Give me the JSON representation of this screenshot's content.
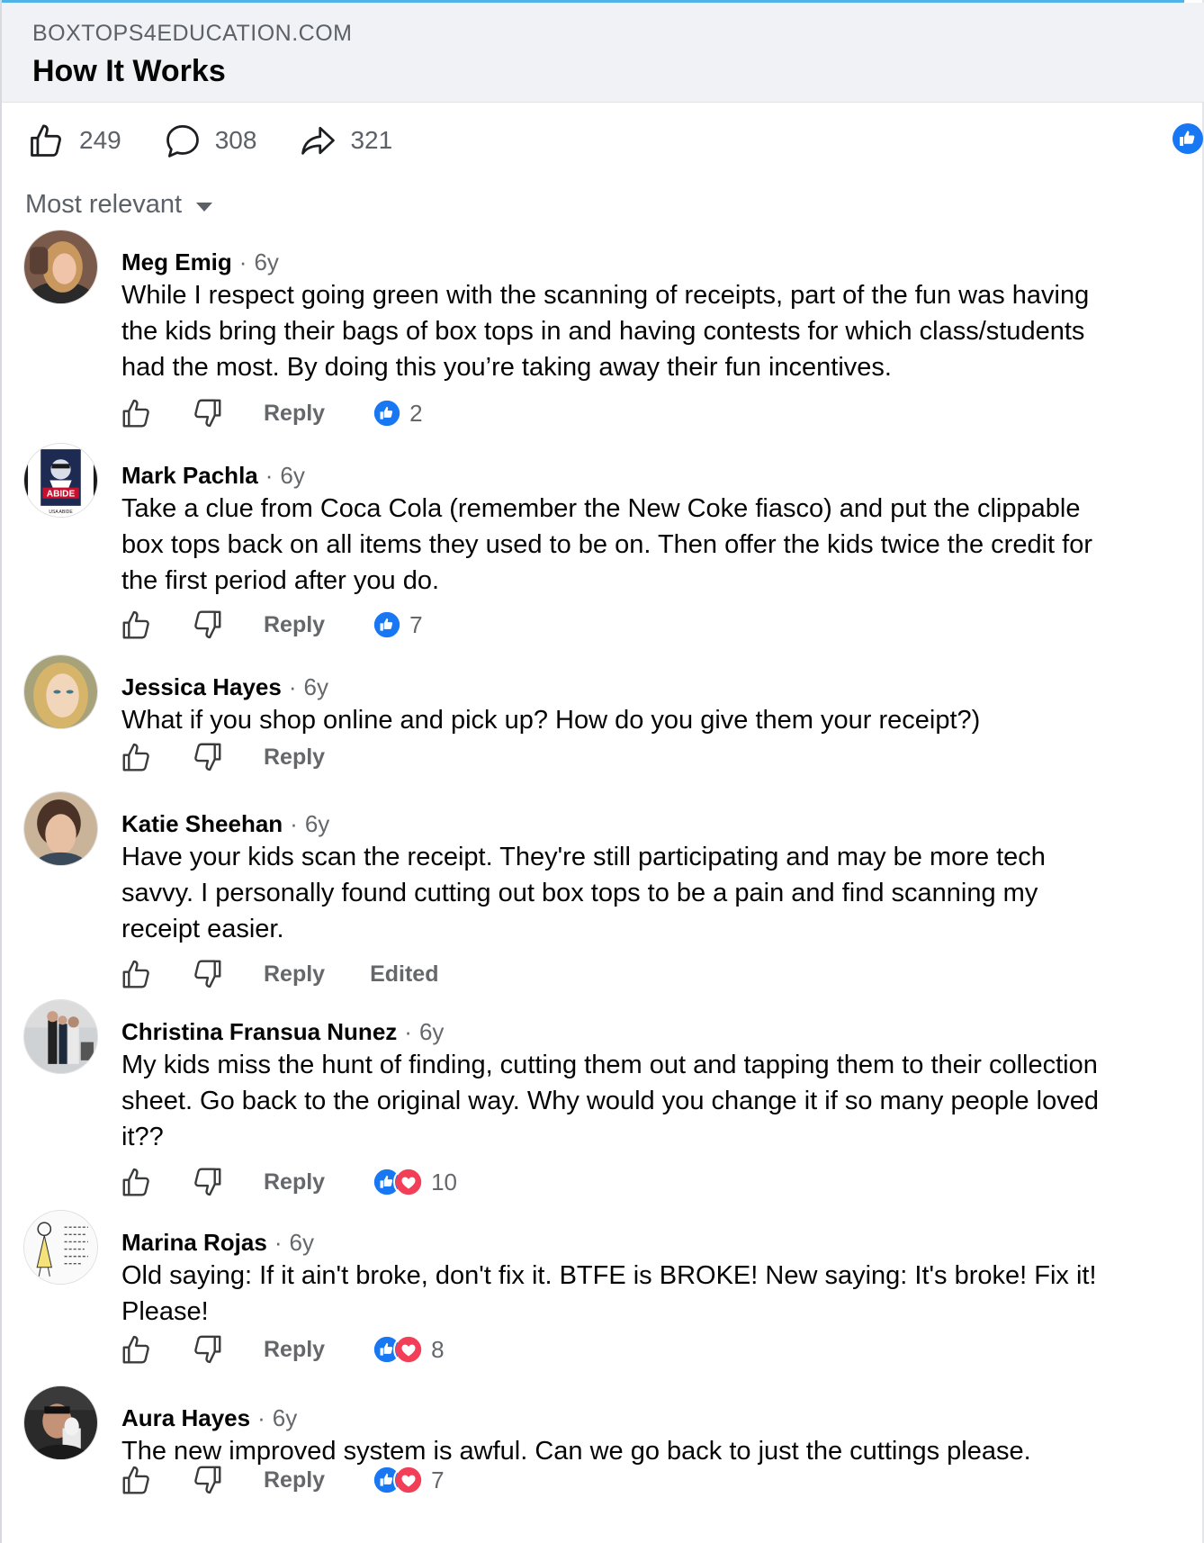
{
  "link_preview": {
    "domain": "BOXTOPS4EDUCATION.COM",
    "title": "How It Works"
  },
  "stats": {
    "likes": "249",
    "comments": "308",
    "shares": "321"
  },
  "sort": {
    "label": "Most relevant"
  },
  "labels": {
    "reply": "Reply",
    "edited": "Edited"
  },
  "colors": {
    "like_blue": "#1877f2",
    "love_red": "#f33e58",
    "meta_gray": "#65676b"
  },
  "comments": [
    {
      "name": "Meg Emig",
      "time": "6y",
      "lines": [
        "While I respect going green with the scanning of receipts, part of the fun was having",
        "the kids bring their bags of box tops in and having contests for which class/students",
        "had the most. By doing this you’re taking away their fun incentives."
      ],
      "reactions": [
        "like"
      ],
      "reaction_count": "2",
      "edited": false
    },
    {
      "name": "Mark Pachla",
      "time": "6y",
      "avatar_text": [
        "ABIDE",
        "USA ABIDE"
      ],
      "lines": [
        "Take a clue from Coca Cola (remember the New Coke fiasco) and put the clippable",
        "box tops back on all items they used to be on. Then offer the kids twice the credit for",
        "the first period after you do."
      ],
      "reactions": [
        "like"
      ],
      "reaction_count": "7",
      "edited": false
    },
    {
      "name": "Jessica Hayes",
      "time": "6y",
      "lines": [
        "What if you shop online and pick up? How do you give them your receipt?)"
      ],
      "reactions": [],
      "reaction_count": "",
      "edited": false
    },
    {
      "name": "Katie Sheehan",
      "time": "6y",
      "lines": [
        "Have your kids scan the receipt. They're still participating and may be more tech",
        "savvy. I personally found cutting out box tops to be a pain and find scanning my",
        "receipt easier."
      ],
      "reactions": [],
      "reaction_count": "",
      "edited": true
    },
    {
      "name": "Christina Fransua Nunez",
      "time": "6y",
      "lines": [
        "My kids miss the hunt of finding, cutting them out and tapping them to their collection",
        "sheet. Go back to the original way. Why would you change it if so many people loved",
        "it??"
      ],
      "reactions": [
        "like",
        "love"
      ],
      "reaction_count": "10",
      "edited": false
    },
    {
      "name": "Marina Rojas",
      "time": "6y",
      "lines": [
        "Old saying: If it ain't broke, don't fix it. BTFE is BROKE! New saying: It's broke! Fix it!",
        "Please!"
      ],
      "reactions": [
        "like",
        "love"
      ],
      "reaction_count": "8",
      "edited": false
    },
    {
      "name": "Aura Hayes",
      "time": "6y",
      "lines": [
        "The new improved system is awful. Can we go back to just the cuttings please."
      ],
      "reactions": [
        "like",
        "love"
      ],
      "reaction_count": "7",
      "edited": false
    }
  ]
}
